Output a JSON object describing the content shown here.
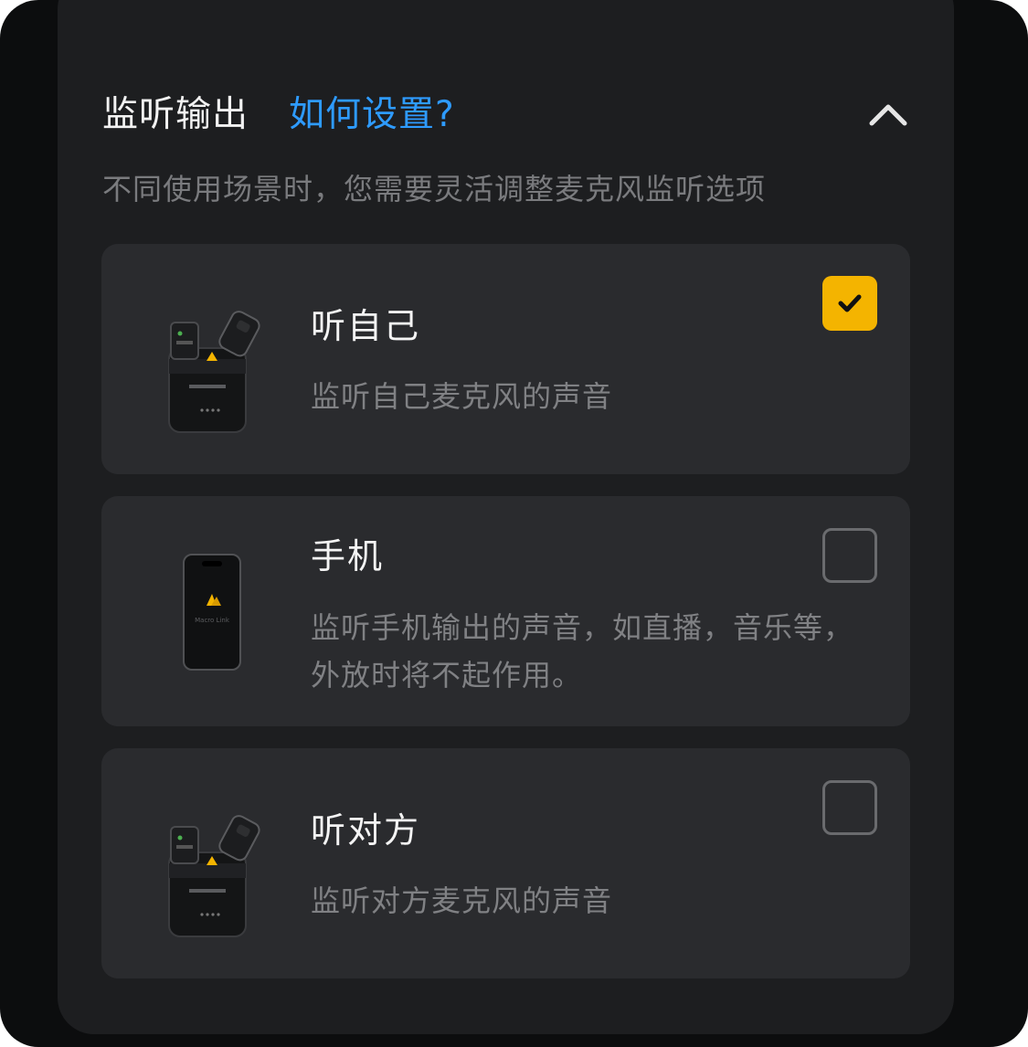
{
  "header": {
    "title": "监听输出",
    "help_link": "如何设置?",
    "subtitle": "不同使用场景时，您需要灵活调整麦克风监听选项"
  },
  "options": [
    {
      "title": "听自己",
      "desc": "监听自己麦克风的声音",
      "checked": true,
      "icon": "mic-charging-case-icon"
    },
    {
      "title": "手机",
      "desc": "监听手机输出的声音，如直播，音乐等，外放时将不起作用。",
      "checked": false,
      "icon": "phone-icon"
    },
    {
      "title": "听对方",
      "desc": "监听对方麦克风的声音",
      "checked": false,
      "icon": "mic-charging-case-icon"
    }
  ],
  "phone_screen_label": "Macro Link",
  "colors": {
    "accent": "#f4b400",
    "link": "#2e9bff",
    "card": "#2a2b2e",
    "panel": "#1d1e20"
  }
}
